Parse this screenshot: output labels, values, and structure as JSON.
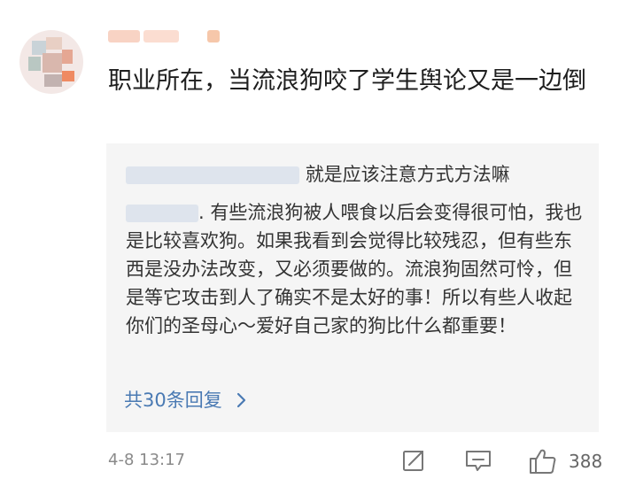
{
  "comment": {
    "text": "职业所在，当流浪狗咬了学生舆论又是一边倒"
  },
  "quoted": {
    "reply1_suffix": "就是应该注意方式方法嘛",
    "reply2_text": ". 有些流浪狗被人喂食以后会变得很可怕，我也是比较喜欢狗。如果我看到会觉得比较残忍，但有些东西是没办法改变，又必须要做的。流浪狗固然可怜，但是等它攻击到人了确实不是太好的事！所以有些人收起你们的圣母心～爱好自己家的狗比什么都重要！",
    "more_replies": "共30条回复"
  },
  "footer": {
    "time": "4-8 13:17",
    "like_count": "388"
  },
  "icons": [
    "share-icon",
    "comment-icon",
    "thumbs-up-icon",
    "chevron-right-icon"
  ],
  "colors": {
    "link": "#4a7ab3",
    "quote_bg": "#f5f5f5",
    "meta": "#8a8a8a"
  }
}
